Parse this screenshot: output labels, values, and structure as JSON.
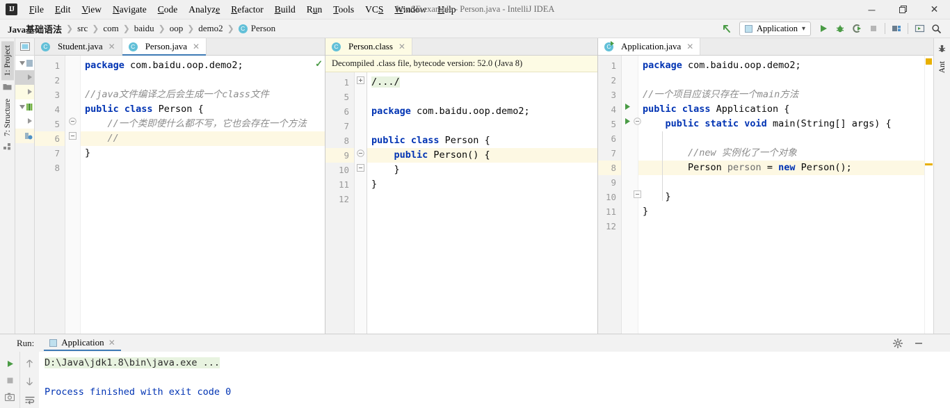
{
  "window": {
    "title": "JavaSE example - Person.java - IntelliJ IDEA",
    "logo": "IJ",
    "minimize": "─",
    "maximize": "❐",
    "close": "✕"
  },
  "menubar": {
    "items": [
      {
        "label": "File",
        "icon": "menu-file"
      },
      {
        "label": "Edit",
        "icon": "menu-edit"
      },
      {
        "label": "View",
        "icon": "menu-view"
      },
      {
        "label": "Navigate",
        "icon": "menu-navigate"
      },
      {
        "label": "Code",
        "icon": "menu-code"
      },
      {
        "label": "Analyze",
        "icon": "menu-analyze"
      },
      {
        "label": "Refactor",
        "icon": "menu-refactor"
      },
      {
        "label": "Build",
        "icon": "menu-build"
      },
      {
        "label": "Run",
        "icon": "menu-run"
      },
      {
        "label": "Tools",
        "icon": "menu-tools"
      },
      {
        "label": "VCS",
        "icon": "menu-vcs"
      },
      {
        "label": "Window",
        "icon": "menu-window"
      },
      {
        "label": "Help",
        "icon": "menu-help"
      }
    ]
  },
  "breadcrumb": {
    "separator": "❯",
    "items": [
      {
        "label": "Java基础语法",
        "bold": true
      },
      {
        "label": "src",
        "bold": false
      },
      {
        "label": "com",
        "bold": false
      },
      {
        "label": "baidu",
        "bold": false
      },
      {
        "label": "oop",
        "bold": false
      },
      {
        "label": "demo2",
        "bold": false
      }
    ],
    "class_item": {
      "badge": "C",
      "label": "Person"
    }
  },
  "toolbar": {
    "back_arrow_icon": "back-arrow-icon",
    "run_config": {
      "label": "Application",
      "caret": "▾"
    },
    "buttons": [
      {
        "name": "run-button",
        "icon": "play-icon",
        "color": "#4a9b45"
      },
      {
        "name": "debug-button",
        "icon": "debug-bug-icon",
        "color": "#4a9b45"
      },
      {
        "name": "run-coverage-button",
        "icon": "coverage-icon",
        "color": "#4a9b45"
      },
      {
        "name": "stop-button",
        "icon": "stop-square-icon",
        "color": "#b0b0b0"
      },
      {
        "name": "project-structure-button",
        "icon": "project-structure-icon",
        "color": "#5a6b7a"
      },
      {
        "name": "terminal-button",
        "icon": "terminal-icon",
        "color": "#5a6b7a"
      },
      {
        "name": "search-everywhere-button",
        "icon": "search-icon",
        "color": "#3c3c3c"
      }
    ]
  },
  "left_strip": {
    "tabs": [
      {
        "label": "1: Project",
        "active": true,
        "icon": "project-folder-icon"
      },
      {
        "label": "7: Structure",
        "active": false,
        "icon": "structure-icon"
      }
    ]
  },
  "right_strip": {
    "tabs": [
      {
        "label": "Ant",
        "icon": "ant-icon"
      }
    ]
  },
  "editor_tabs": {
    "left_group": [
      {
        "label": "Student.java",
        "badge": "C",
        "selected": false,
        "close": "✕"
      },
      {
        "label": "Person.java",
        "badge": "C",
        "selected": true,
        "close": "✕"
      }
    ],
    "middle_group": [
      {
        "label": "Person.class",
        "badge": "C",
        "selected": true,
        "close": "✕"
      }
    ],
    "right_group": [
      {
        "label": "Application.java",
        "badge": "C",
        "selected": true,
        "close": "✕",
        "runnable": true
      }
    ]
  },
  "panes": {
    "person_java": {
      "inspection_status_icon": "inspection-ok-check",
      "lines": [
        {
          "n": "1",
          "hl": false,
          "tokens": [
            {
              "t": "package ",
              "c": "kw"
            },
            {
              "t": "com.baidu.oop.demo2;",
              "c": "plain"
            }
          ]
        },
        {
          "n": "2",
          "hl": false,
          "tokens": []
        },
        {
          "n": "3",
          "hl": false,
          "tokens": [
            {
              "t": "//java文件编译之后会生成一个class文件",
              "c": "cmt"
            }
          ]
        },
        {
          "n": "4",
          "hl": false,
          "tokens": [
            {
              "t": "public class ",
              "c": "kw"
            },
            {
              "t": "Person {",
              "c": "plain"
            }
          ]
        },
        {
          "n": "5",
          "hl": false,
          "tokens": [
            {
              "t": "    //一个类即使什么都不写，它也会存在一个方法",
              "c": "cmt"
            }
          ]
        },
        {
          "n": "6",
          "hl": true,
          "tokens": [
            {
              "t": "    //",
              "c": "cmt"
            }
          ]
        },
        {
          "n": "7",
          "hl": false,
          "tokens": [
            {
              "t": "}",
              "c": "plain"
            }
          ]
        },
        {
          "n": "8",
          "hl": false,
          "tokens": []
        }
      ]
    },
    "person_class": {
      "notice": "Decompiled .class file, bytecode version: 52.0 (Java 8)",
      "lines": [
        {
          "n": "1",
          "hl": false,
          "fold": "plus",
          "tokens": [
            {
              "t": "/.../",
              "c": "hlbox"
            }
          ]
        },
        {
          "n": "5",
          "hl": false,
          "fold": "",
          "tokens": []
        },
        {
          "n": "6",
          "hl": false,
          "fold": "",
          "tokens": [
            {
              "t": "package ",
              "c": "kw"
            },
            {
              "t": "com.baidu.oop.demo2;",
              "c": "plain"
            }
          ]
        },
        {
          "n": "7",
          "hl": false,
          "fold": "",
          "tokens": []
        },
        {
          "n": "8",
          "hl": false,
          "fold": "",
          "tokens": [
            {
              "t": "public class ",
              "c": "kw"
            },
            {
              "t": "Person {",
              "c": "plain"
            }
          ]
        },
        {
          "n": "9",
          "hl": true,
          "fold": "minus-round",
          "tokens": [
            {
              "t": "    public ",
              "c": "kw"
            },
            {
              "t": "Person() {",
              "c": "plain"
            }
          ]
        },
        {
          "n": "10",
          "hl": false,
          "fold": "minus",
          "tokens": [
            {
              "t": "    }",
              "c": "plain"
            }
          ]
        },
        {
          "n": "11",
          "hl": false,
          "fold": "",
          "tokens": [
            {
              "t": "}",
              "c": "plain"
            }
          ]
        },
        {
          "n": "12",
          "hl": false,
          "fold": "",
          "tokens": []
        }
      ]
    },
    "application_java": {
      "lines": [
        {
          "n": "1",
          "hl": false,
          "gutter_icon": "",
          "tokens": [
            {
              "t": "package ",
              "c": "kw"
            },
            {
              "t": "com.baidu.oop.demo2;",
              "c": "plain"
            }
          ]
        },
        {
          "n": "2",
          "hl": false,
          "gutter_icon": "",
          "tokens": []
        },
        {
          "n": "3",
          "hl": false,
          "gutter_icon": "",
          "tokens": [
            {
              "t": "//一个项目应该只存在一个main方法",
              "c": "cmt"
            }
          ]
        },
        {
          "n": "4",
          "hl": false,
          "gutter_icon": "run-gutter-icon",
          "tokens": [
            {
              "t": "public class ",
              "c": "kw"
            },
            {
              "t": "Application {",
              "c": "plain"
            }
          ]
        },
        {
          "n": "5",
          "hl": false,
          "gutter_icon": "run-gutter-icon",
          "tokens": [
            {
              "t": "    public static void ",
              "c": "kw"
            },
            {
              "t": "main(String[] args) {",
              "c": "plain"
            }
          ]
        },
        {
          "n": "6",
          "hl": false,
          "gutter_icon": "",
          "tokens": []
        },
        {
          "n": "7",
          "hl": false,
          "gutter_icon": "",
          "tokens": [
            {
              "t": "        //new 实例化了一个对象",
              "c": "cmt"
            }
          ]
        },
        {
          "n": "8",
          "hl": true,
          "gutter_icon": "",
          "tokens": [
            {
              "t": "        Person ",
              "c": "plain"
            },
            {
              "t": "person",
              "c": "var"
            },
            {
              "t": " = ",
              "c": "plain"
            },
            {
              "t": "new ",
              "c": "kw"
            },
            {
              "t": "Person();",
              "c": "plain"
            }
          ]
        },
        {
          "n": "9",
          "hl": false,
          "gutter_icon": "",
          "tokens": []
        },
        {
          "n": "10",
          "hl": false,
          "gutter_icon": "",
          "tokens": [
            {
              "t": "    }",
              "c": "plain"
            }
          ]
        },
        {
          "n": "11",
          "hl": false,
          "gutter_icon": "",
          "tokens": [
            {
              "t": "}",
              "c": "plain"
            }
          ]
        },
        {
          "n": "12",
          "hl": false,
          "gutter_icon": "",
          "tokens": []
        }
      ],
      "marker_color": "#e8b000"
    }
  },
  "run_panel": {
    "label": "Run:",
    "tab": {
      "label": "Application",
      "close": "✕"
    },
    "settings_icon": "gear-icon",
    "minimize_icon": "minimize-icon",
    "left_tools": [
      {
        "name": "rerun-button",
        "icon": "play-icon"
      },
      {
        "name": "stop-button",
        "icon": "stop-square-icon"
      },
      {
        "name": "screenshot-button",
        "icon": "camera-icon"
      }
    ],
    "right_tools": [
      {
        "name": "up-button",
        "icon": "arrow-up-icon"
      },
      {
        "name": "down-button",
        "icon": "arrow-down-icon"
      },
      {
        "name": "soft-wrap-button",
        "icon": "soft-wrap-icon"
      }
    ],
    "console": [
      {
        "text": "D:\\Java\\jdk1.8\\bin\\java.exe ...",
        "style": "green"
      },
      {
        "text": "",
        "style": "plain"
      },
      {
        "text": "Process finished with exit code 0",
        "style": "blue"
      }
    ]
  },
  "colors": {
    "accent_blue": "#3d7ab5",
    "keyword": "#0033b3",
    "comment": "#8c8c8c",
    "green_run": "#4a9b45",
    "highlight_line": "#fdf8e3",
    "notice_bg": "#fdfbe4",
    "marker_yellow": "#e8b000"
  }
}
